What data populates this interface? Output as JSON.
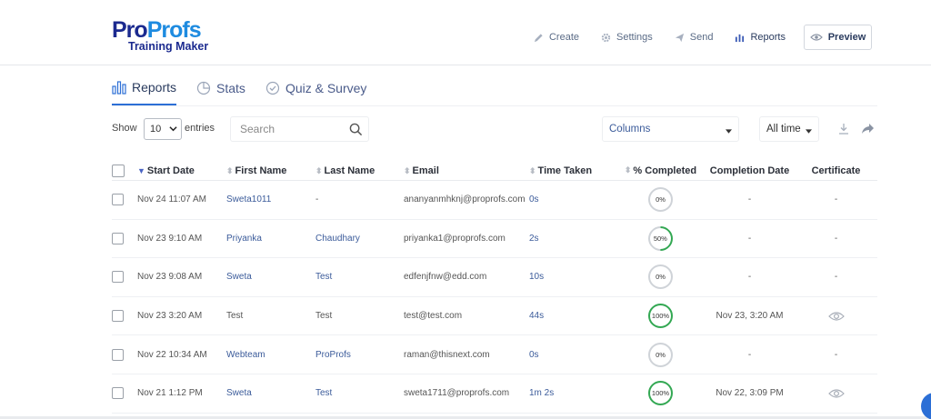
{
  "brand": {
    "name_part1": "Pro",
    "name_part2": "Profs",
    "subtitle": "Training Maker"
  },
  "nav": {
    "items": [
      {
        "label": "Create",
        "icon": "pencil-icon"
      },
      {
        "label": "Settings",
        "icon": "gear-icon"
      },
      {
        "label": "Send",
        "icon": "send-icon"
      },
      {
        "label": "Reports",
        "icon": "bar-chart-icon",
        "active": true
      }
    ],
    "preview_label": "Preview"
  },
  "tabs": [
    {
      "label": "Reports",
      "icon": "bar-chart-icon",
      "active": true
    },
    {
      "label": "Stats",
      "icon": "pie-chart-icon"
    },
    {
      "label": "Quiz & Survey",
      "icon": "check-circle-icon"
    }
  ],
  "controls": {
    "show_label": "Show",
    "entries_value": "10",
    "entries_label": "entries",
    "search_placeholder": "Search",
    "columns_label": "Columns",
    "time_label": "All time"
  },
  "table": {
    "headers": [
      "Start Date",
      "First Name",
      "Last Name",
      "Email",
      "Time Taken",
      "% Completed",
      "Completion Date",
      "Certificate"
    ],
    "rows": [
      {
        "start": "Nov 24 11:07 AM",
        "first": "Sweta1011",
        "last": "-",
        "email": "ananyanmhknj@proprofs.com",
        "time": "0s",
        "pct": "0%",
        "pct_value": 0,
        "completion": "-",
        "cert": "-"
      },
      {
        "start": "Nov 23 9:10 AM",
        "first": "Priyanka",
        "last": "Chaudhary",
        "email": "priyanka1@proprofs.com",
        "time": "2s",
        "pct": "50%",
        "pct_value": 50,
        "completion": "-",
        "cert": "-"
      },
      {
        "start": "Nov 23 9:08 AM",
        "first": "Sweta",
        "last": "Test",
        "email": "edfenjfnw@edd.com",
        "time": "10s",
        "pct": "0%",
        "pct_value": 0,
        "completion": "-",
        "cert": "-"
      },
      {
        "start": "Nov 23 3:20 AM",
        "first": "Test",
        "last": "Test",
        "email": "test@test.com",
        "time": "44s",
        "pct": "100%",
        "pct_value": 100,
        "completion": "Nov 23, 3:20 AM",
        "cert": "eye-icon"
      },
      {
        "start": "Nov 22 10:34 AM",
        "first": "Webteam",
        "last": "ProProfs",
        "email": "raman@thisnext.com",
        "time": "0s",
        "pct": "0%",
        "pct_value": 0,
        "completion": "-",
        "cert": "-"
      },
      {
        "start": "Nov 21 1:12 PM",
        "first": "Sweta",
        "last": "Test",
        "email": "sweta1711@proprofs.com",
        "time": "1m 2s",
        "pct": "100%",
        "pct_value": 100,
        "completion": "Nov 22, 3:09 PM",
        "cert": "eye-icon"
      }
    ]
  },
  "colors": {
    "accent": "#2c6fd6",
    "complete": "#33a853",
    "link": "#3b5b9a"
  }
}
